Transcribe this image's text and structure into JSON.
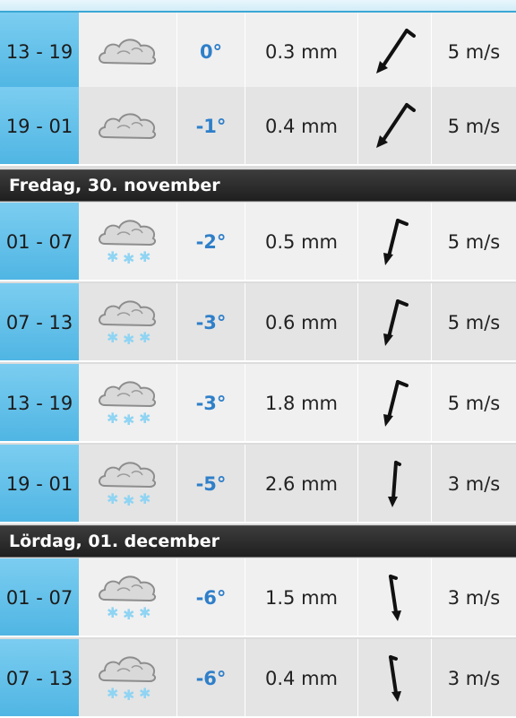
{
  "days": [
    {
      "label": "Fredag, 30. november"
    },
    {
      "label": "Lördag, 01. december"
    }
  ],
  "rows": [
    {
      "time": "13 - 19",
      "icon": "cloud-icon",
      "temp": "0°",
      "precip": "0.3 mm",
      "wind": "5 m/s",
      "wind_dir": "south-west-arrow-icon"
    },
    {
      "time": "19 - 01",
      "icon": "cloud-icon",
      "temp": "-1°",
      "precip": "0.4 mm",
      "wind": "5 m/s",
      "wind_dir": "south-west-arrow-icon"
    },
    {
      "time": "01 - 07",
      "icon": "snow-cloud-icon",
      "temp": "-2°",
      "precip": "0.5 mm",
      "wind": "5 m/s",
      "wind_dir": "south-south-west-arrow-icon"
    },
    {
      "time": "07 - 13",
      "icon": "snow-cloud-icon",
      "temp": "-3°",
      "precip": "0.6 mm",
      "wind": "5 m/s",
      "wind_dir": "south-south-west-arrow-icon"
    },
    {
      "time": "13 - 19",
      "icon": "snow-cloud-icon",
      "temp": "-3°",
      "precip": "1.8 mm",
      "wind": "5 m/s",
      "wind_dir": "south-south-west-arrow-icon"
    },
    {
      "time": "19 - 01",
      "icon": "snow-cloud-icon",
      "temp": "-5°",
      "precip": "2.6 mm",
      "wind": "3 m/s",
      "wind_dir": "south-arrow-icon"
    },
    {
      "time": "01 - 07",
      "icon": "snow-cloud-icon",
      "temp": "-6°",
      "precip": "1.5 mm",
      "wind": "3 m/s",
      "wind_dir": "south-arrow-icon"
    },
    {
      "time": "07 - 13",
      "icon": "snow-cloud-icon",
      "temp": "-6°",
      "precip": "0.4 mm",
      "wind": "3 m/s",
      "wind_dir": "south-arrow-icon"
    }
  ]
}
